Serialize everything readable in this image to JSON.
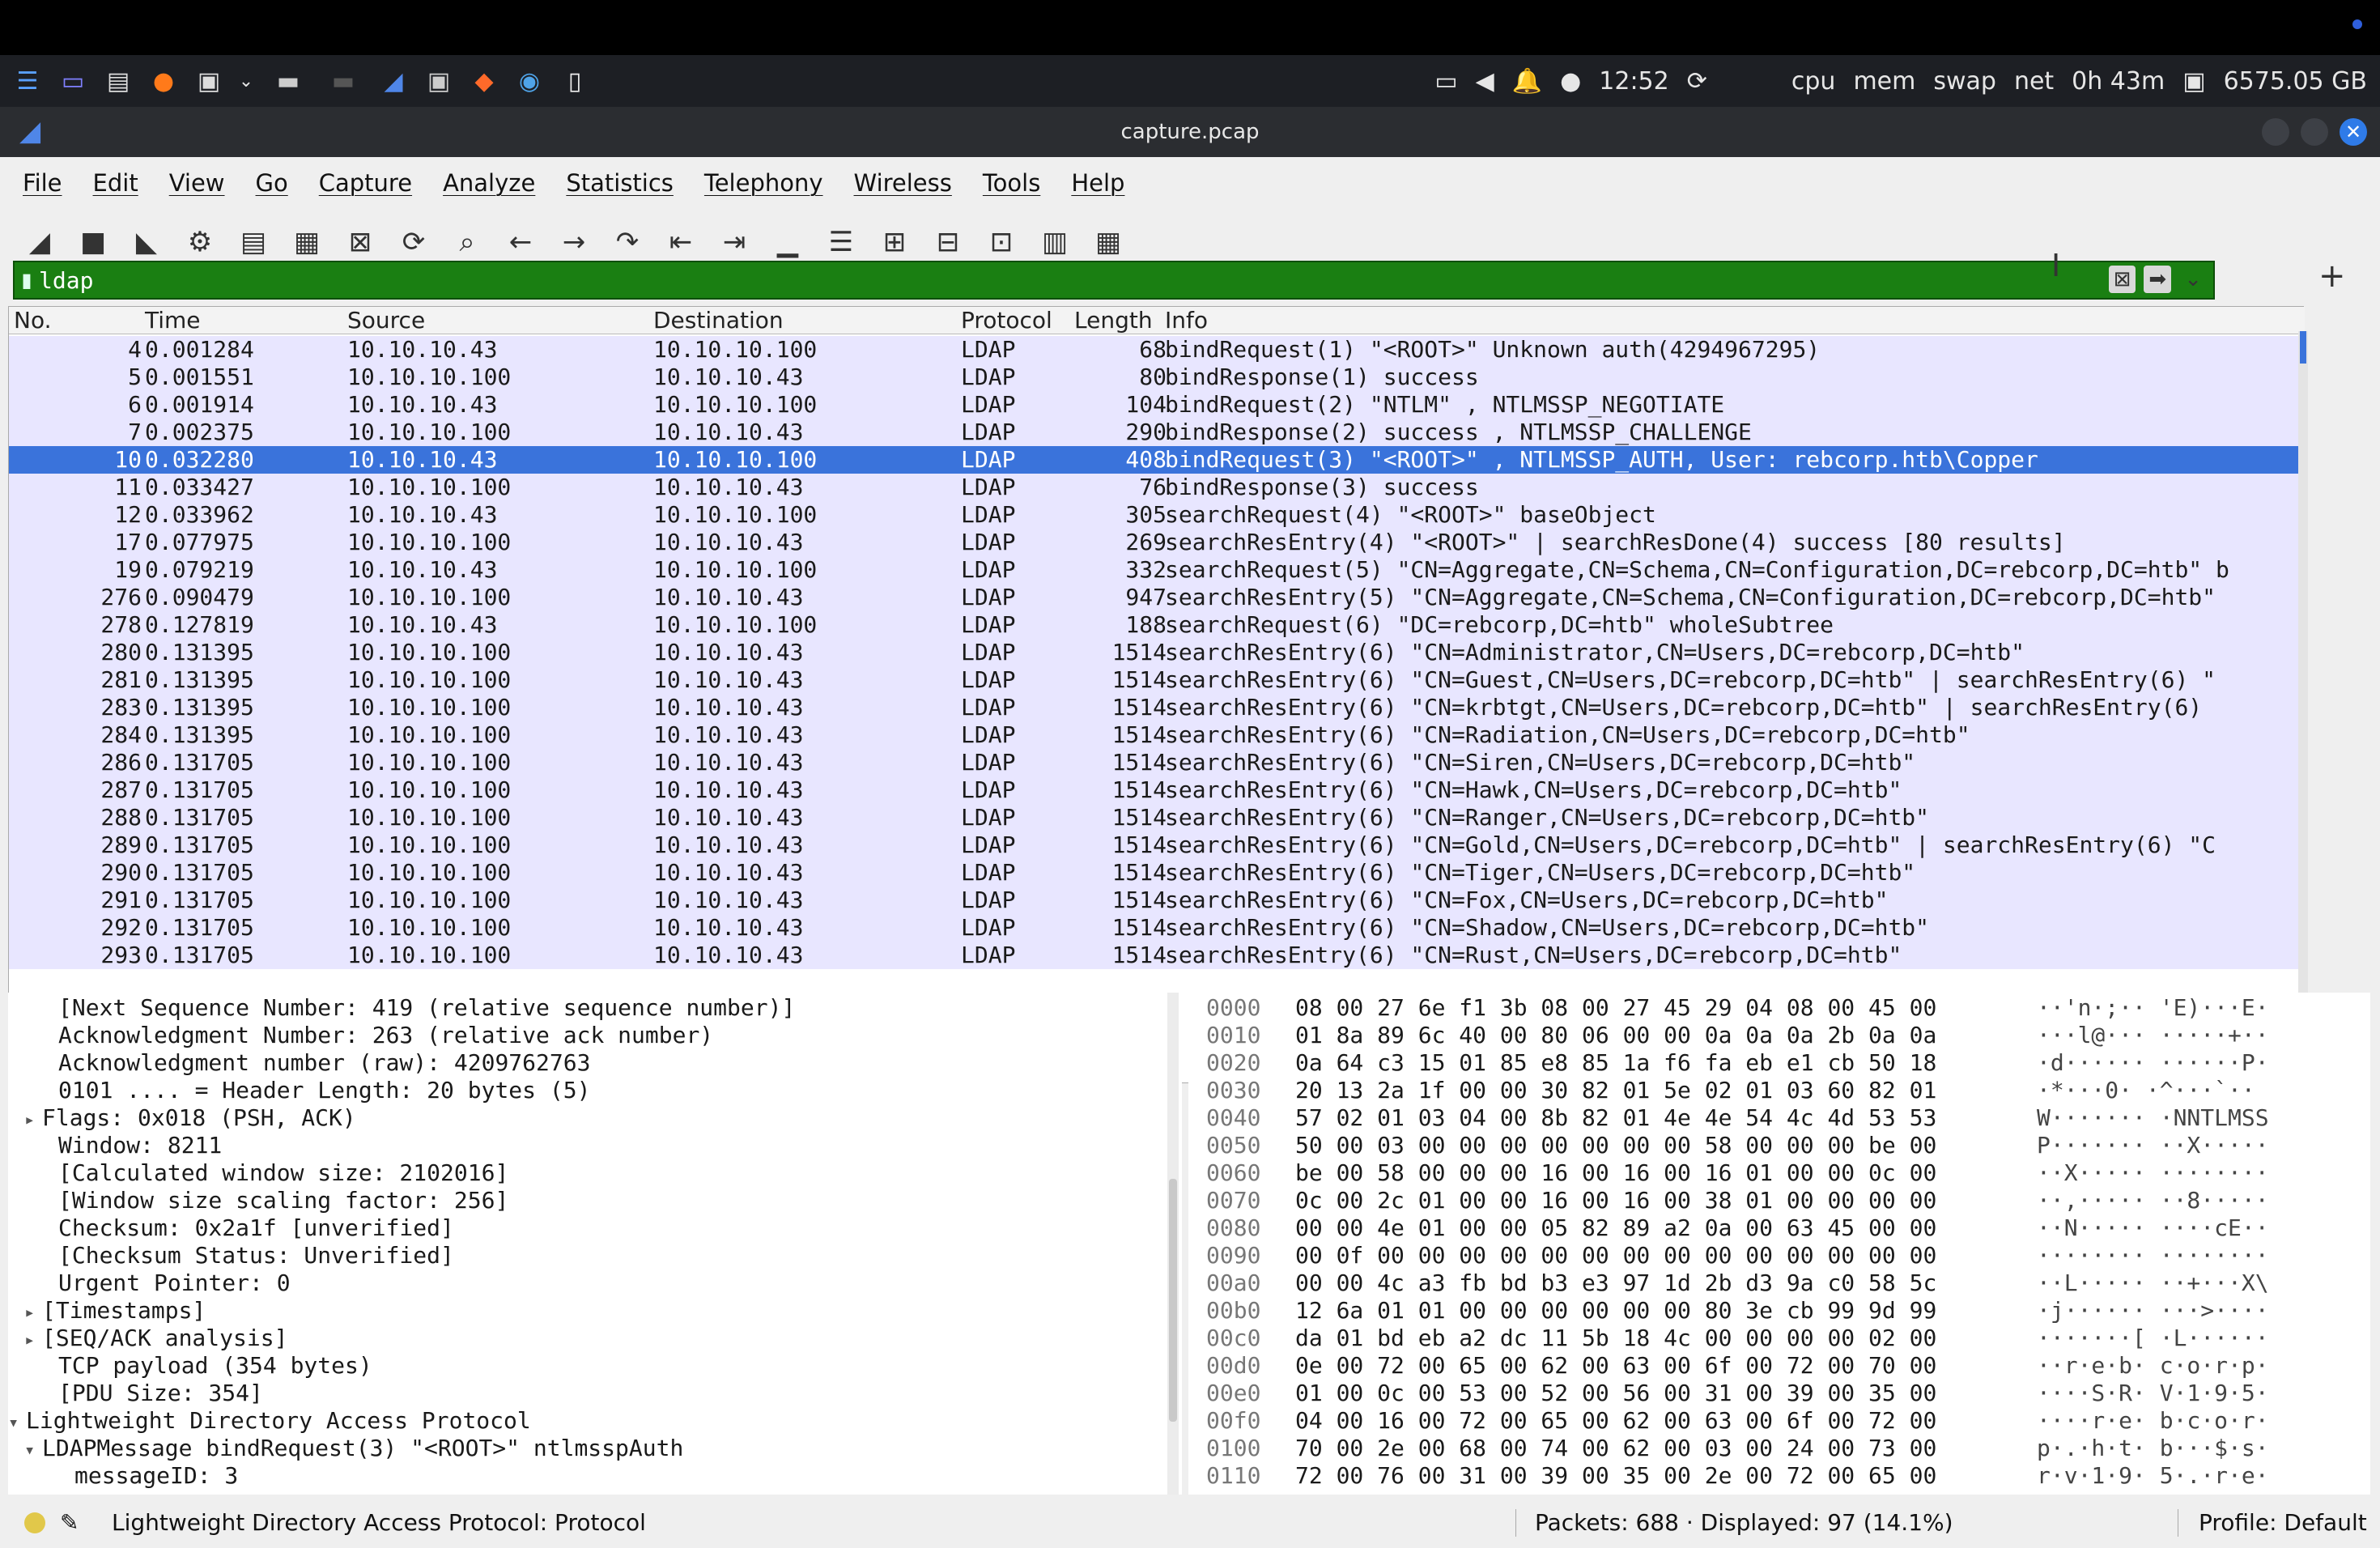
{
  "taskbar": {
    "clock": "12:52",
    "monitors": [
      "cpu",
      "mem",
      "swap",
      "net"
    ],
    "uptime": "0h 43m",
    "disk": "6575.05 GB"
  },
  "window": {
    "title": "capture.pcap"
  },
  "menu": [
    "File",
    "Edit",
    "View",
    "Go",
    "Capture",
    "Analyze",
    "Statistics",
    "Telephony",
    "Wireless",
    "Tools",
    "Help"
  ],
  "toolbar_icons": [
    "shark-fin-icon",
    "stop-icon",
    "restart-icon",
    "options-gear-icon",
    "open-icon",
    "save-icon",
    "close-file-icon",
    "reload-icon",
    "find-icon",
    "back-arrow-icon",
    "forward-arrow-icon",
    "goto-icon",
    "first-packet-icon",
    "last-packet-icon",
    "autoscroll-icon",
    "colorize-icon",
    "zoom-in-icon",
    "zoom-out-icon",
    "normal-size-icon",
    "resize-columns-icon",
    "layout-icon"
  ],
  "filter": {
    "value": "ldap"
  },
  "packet_columns": [
    "No.",
    "Time",
    "Source",
    "Destination",
    "Protocol",
    "Length",
    "Info"
  ],
  "packets": [
    {
      "no": "4",
      "time": "0.001284",
      "src": "10.10.10.43",
      "dst": "10.10.10.100",
      "proto": "LDAP",
      "len": "68",
      "info": "bindRequest(1) \"<ROOT>\" Unknown auth(4294967295)",
      "selected": false
    },
    {
      "no": "5",
      "time": "0.001551",
      "src": "10.10.10.100",
      "dst": "10.10.10.43",
      "proto": "LDAP",
      "len": "80",
      "info": "bindResponse(1) success",
      "selected": false
    },
    {
      "no": "6",
      "time": "0.001914",
      "src": "10.10.10.43",
      "dst": "10.10.10.100",
      "proto": "LDAP",
      "len": "104",
      "info": "bindRequest(2) \"NTLM\" , NTLMSSP_NEGOTIATE",
      "selected": false
    },
    {
      "no": "7",
      "time": "0.002375",
      "src": "10.10.10.100",
      "dst": "10.10.10.43",
      "proto": "LDAP",
      "len": "290",
      "info": "bindResponse(2) success , NTLMSSP_CHALLENGE",
      "selected": false
    },
    {
      "no": "10",
      "time": "0.032280",
      "src": "10.10.10.43",
      "dst": "10.10.10.100",
      "proto": "LDAP",
      "len": "408",
      "info": "bindRequest(3) \"<ROOT>\" , NTLMSSP_AUTH, User: rebcorp.htb\\Copper",
      "selected": true
    },
    {
      "no": "11",
      "time": "0.033427",
      "src": "10.10.10.100",
      "dst": "10.10.10.43",
      "proto": "LDAP",
      "len": "76",
      "info": "bindResponse(3) success",
      "selected": false
    },
    {
      "no": "12",
      "time": "0.033962",
      "src": "10.10.10.43",
      "dst": "10.10.10.100",
      "proto": "LDAP",
      "len": "305",
      "info": "searchRequest(4) \"<ROOT>\" baseObject",
      "selected": false
    },
    {
      "no": "17",
      "time": "0.077975",
      "src": "10.10.10.100",
      "dst": "10.10.10.43",
      "proto": "LDAP",
      "len": "269",
      "info": "searchResEntry(4) \"<ROOT>\"  | searchResDone(4) success  [80 results]",
      "selected": false
    },
    {
      "no": "19",
      "time": "0.079219",
      "src": "10.10.10.43",
      "dst": "10.10.10.100",
      "proto": "LDAP",
      "len": "332",
      "info": "searchRequest(5) \"CN=Aggregate,CN=Schema,CN=Configuration,DC=rebcorp,DC=htb\" b",
      "selected": false
    },
    {
      "no": "276",
      "time": "0.090479",
      "src": "10.10.10.100",
      "dst": "10.10.10.43",
      "proto": "LDAP",
      "len": "947",
      "info": "searchResEntry(5) \"CN=Aggregate,CN=Schema,CN=Configuration,DC=rebcorp,DC=htb\"",
      "selected": false
    },
    {
      "no": "278",
      "time": "0.127819",
      "src": "10.10.10.43",
      "dst": "10.10.10.100",
      "proto": "LDAP",
      "len": "188",
      "info": "searchRequest(6) \"DC=rebcorp,DC=htb\" wholeSubtree",
      "selected": false
    },
    {
      "no": "280",
      "time": "0.131395",
      "src": "10.10.10.100",
      "dst": "10.10.10.43",
      "proto": "LDAP",
      "len": "1514",
      "info": "searchResEntry(6) \"CN=Administrator,CN=Users,DC=rebcorp,DC=htb\"",
      "selected": false
    },
    {
      "no": "281",
      "time": "0.131395",
      "src": "10.10.10.100",
      "dst": "10.10.10.43",
      "proto": "LDAP",
      "len": "1514",
      "info": "searchResEntry(6) \"CN=Guest,CN=Users,DC=rebcorp,DC=htb\"  | searchResEntry(6) \"",
      "selected": false
    },
    {
      "no": "283",
      "time": "0.131395",
      "src": "10.10.10.100",
      "dst": "10.10.10.43",
      "proto": "LDAP",
      "len": "1514",
      "info": "searchResEntry(6) \"CN=krbtgt,CN=Users,DC=rebcorp,DC=htb\"  | searchResEntry(6)",
      "selected": false
    },
    {
      "no": "284",
      "time": "0.131395",
      "src": "10.10.10.100",
      "dst": "10.10.10.43",
      "proto": "LDAP",
      "len": "1514",
      "info": "searchResEntry(6) \"CN=Radiation,CN=Users,DC=rebcorp,DC=htb\"",
      "selected": false
    },
    {
      "no": "286",
      "time": "0.131705",
      "src": "10.10.10.100",
      "dst": "10.10.10.43",
      "proto": "LDAP",
      "len": "1514",
      "info": "searchResEntry(6) \"CN=Siren,CN=Users,DC=rebcorp,DC=htb\"",
      "selected": false
    },
    {
      "no": "287",
      "time": "0.131705",
      "src": "10.10.10.100",
      "dst": "10.10.10.43",
      "proto": "LDAP",
      "len": "1514",
      "info": "searchResEntry(6) \"CN=Hawk,CN=Users,DC=rebcorp,DC=htb\"",
      "selected": false
    },
    {
      "no": "288",
      "time": "0.131705",
      "src": "10.10.10.100",
      "dst": "10.10.10.43",
      "proto": "LDAP",
      "len": "1514",
      "info": "searchResEntry(6) \"CN=Ranger,CN=Users,DC=rebcorp,DC=htb\"",
      "selected": false
    },
    {
      "no": "289",
      "time": "0.131705",
      "src": "10.10.10.100",
      "dst": "10.10.10.43",
      "proto": "LDAP",
      "len": "1514",
      "info": "searchResEntry(6) \"CN=Gold,CN=Users,DC=rebcorp,DC=htb\"  | searchResEntry(6) \"C",
      "selected": false
    },
    {
      "no": "290",
      "time": "0.131705",
      "src": "10.10.10.100",
      "dst": "10.10.10.43",
      "proto": "LDAP",
      "len": "1514",
      "info": "searchResEntry(6) \"CN=Tiger,CN=Users,DC=rebcorp,DC=htb\"",
      "selected": false
    },
    {
      "no": "291",
      "time": "0.131705",
      "src": "10.10.10.100",
      "dst": "10.10.10.43",
      "proto": "LDAP",
      "len": "1514",
      "info": "searchResEntry(6) \"CN=Fox,CN=Users,DC=rebcorp,DC=htb\"",
      "selected": false
    },
    {
      "no": "292",
      "time": "0.131705",
      "src": "10.10.10.100",
      "dst": "10.10.10.43",
      "proto": "LDAP",
      "len": "1514",
      "info": "searchResEntry(6) \"CN=Shadow,CN=Users,DC=rebcorp,DC=htb\"",
      "selected": false
    },
    {
      "no": "293",
      "time": "0.131705",
      "src": "10.10.10.100",
      "dst": "10.10.10.43",
      "proto": "LDAP",
      "len": "1514",
      "info": "searchResEntry(6) \"CN=Rust,CN=Users,DC=rebcorp,DC=htb\"",
      "selected": false
    }
  ],
  "details": [
    {
      "indent": 2,
      "expander": "",
      "text": "[Next Sequence Number: 419    (relative sequence number)]"
    },
    {
      "indent": 2,
      "expander": "",
      "text": "Acknowledgment Number: 263    (relative ack number)"
    },
    {
      "indent": 2,
      "expander": "",
      "text": "Acknowledgment number (raw): 4209762763"
    },
    {
      "indent": 2,
      "expander": "",
      "text": "0101 .... = Header Length: 20 bytes (5)"
    },
    {
      "indent": 1,
      "expander": "▸",
      "text": "Flags: 0x018 (PSH, ACK)"
    },
    {
      "indent": 2,
      "expander": "",
      "text": "Window: 8211"
    },
    {
      "indent": 2,
      "expander": "",
      "text": "[Calculated window size: 2102016]"
    },
    {
      "indent": 2,
      "expander": "",
      "text": "[Window size scaling factor: 256]"
    },
    {
      "indent": 2,
      "expander": "",
      "text": "Checksum: 0x2a1f [unverified]"
    },
    {
      "indent": 2,
      "expander": "",
      "text": "[Checksum Status: Unverified]"
    },
    {
      "indent": 2,
      "expander": "",
      "text": "Urgent Pointer: 0"
    },
    {
      "indent": 1,
      "expander": "▸",
      "text": "[Timestamps]"
    },
    {
      "indent": 1,
      "expander": "▸",
      "text": "[SEQ/ACK analysis]"
    },
    {
      "indent": 2,
      "expander": "",
      "text": "TCP payload (354 bytes)"
    },
    {
      "indent": 2,
      "expander": "",
      "text": "[PDU Size: 354]"
    },
    {
      "indent": 0,
      "expander": "▾",
      "text": "Lightweight Directory Access Protocol"
    },
    {
      "indent": 1,
      "expander": "▾",
      "text": "LDAPMessage bindRequest(3) \"<ROOT>\" ntlmsspAuth"
    },
    {
      "indent": 3,
      "expander": "",
      "text": "messageID: 3"
    }
  ],
  "bytes": [
    {
      "off": "0000",
      "hex": "08 00 27 6e f1 3b 08 00   27 45 29 04 08 00 45 00",
      "ascii": "··'n·;·· 'E)···E·"
    },
    {
      "off": "0010",
      "hex": "01 8a 89 6c 40 00 80 06   00 00 0a 0a 0a 2b 0a 0a",
      "ascii": "···l@··· ·····+··"
    },
    {
      "off": "0020",
      "hex": "0a 64 c3 15 01 85 e8 85   1a f6 fa eb e1 cb 50 18",
      "ascii": "·d······ ······P·"
    },
    {
      "off": "0030",
      "hex": "20 13 2a 1f 00 00 30 82   01 5e 02 01 03 60 82 01",
      "ascii": " ·*···0· ·^···`··"
    },
    {
      "off": "0040",
      "hex": "57 02 01 03 04 00 8b 82   01 4e 4e 54 4c 4d 53 53",
      "ascii": "W······· ·NNTLMSS"
    },
    {
      "off": "0050",
      "hex": "50 00 03 00 00 00 00 00   00 00 58 00 00 00 be 00",
      "ascii": "P······· ··X·····"
    },
    {
      "off": "0060",
      "hex": "be 00 58 00 00 00 16 00   16 00 16 01 00 00 0c 00",
      "ascii": "··X····· ········"
    },
    {
      "off": "0070",
      "hex": "0c 00 2c 01 00 00 16 00   16 00 38 01 00 00 00 00",
      "ascii": "··,····· ··8·····"
    },
    {
      "off": "0080",
      "hex": "00 00 4e 01 00 00 05 82   89 a2 0a 00 63 45 00 00",
      "ascii": "··N····· ····cE··"
    },
    {
      "off": "0090",
      "hex": "00 0f 00 00 00 00 00 00   00 00 00 00 00 00 00 00",
      "ascii": "········ ········"
    },
    {
      "off": "00a0",
      "hex": "00 00 4c a3 fb bd b3 e3   97 1d 2b d3 9a c0 58 5c",
      "ascii": "··L····· ··+···X\\"
    },
    {
      "off": "00b0",
      "hex": "12 6a 01 01 00 00 00 00   00 00 80 3e cb 99 9d 99",
      "ascii": "·j······ ···>····"
    },
    {
      "off": "00c0",
      "hex": "da 01 bd eb a2 dc 11 5b   18 4c 00 00 00 00 02 00",
      "ascii": "·······[ ·L······"
    },
    {
      "off": "00d0",
      "hex": "0e 00 72 00 65 00 62 00   63 00 6f 00 72 00 70 00",
      "ascii": "··r·e·b· c·o·r·p·"
    },
    {
      "off": "00e0",
      "hex": "01 00 0c 00 53 00 52 00   56 00 31 00 39 00 35 00",
      "ascii": "····S·R· V·1·9·5·"
    },
    {
      "off": "00f0",
      "hex": "04 00 16 00 72 00 65 00   62 00 63 00 6f 00 72 00",
      "ascii": "····r·e· b·c·o·r·"
    },
    {
      "off": "0100",
      "hex": "70 00 2e 00 68 00 74 00   62 00 03 00 24 00 73 00",
      "ascii": "p·.·h·t· b···$·s·"
    },
    {
      "off": "0110",
      "hex": "72 00 76 00 31 00 39 00   35 00 2e 00 72 00 65 00",
      "ascii": "r·v·1·9· 5·.·r·e·"
    }
  ],
  "status": {
    "text": "Lightweight Directory Access Protocol: Protocol",
    "packets": "Packets: 688 · Displayed: 97 (14.1%)",
    "profile": "Profile: Default"
  },
  "colors": {
    "filter_ok": "#1a7f12",
    "selected_row": "#3a73db",
    "ldap_row": "#e8e6ff"
  }
}
